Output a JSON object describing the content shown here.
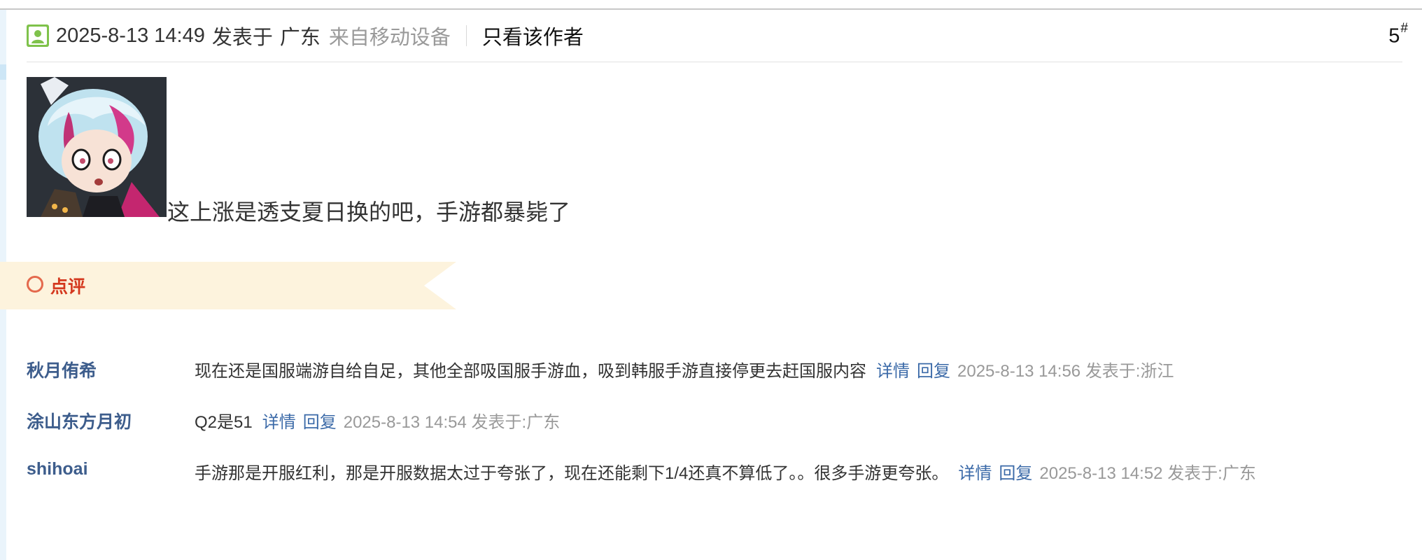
{
  "header": {
    "time": "2025-8-13 14:49",
    "posted_at": "发表于",
    "location": "广东",
    "device": "来自移动设备",
    "only_author": "只看该作者",
    "floor_number": "5",
    "floor_symbol": "#"
  },
  "post": {
    "avatar_icon": "anime-character-avatar",
    "text": "这上涨是透支夏日换的吧，手游都暴毙了"
  },
  "comment_section": {
    "label": "点评",
    "banner_color": "#fdf3dd",
    "label_color": "#d4381e"
  },
  "comments": [
    {
      "user": "秋月侑希",
      "text": "现在还是国服端游自给自足，其他全部吸国服手游血，吸到韩服手游直接停更去赶国服内容",
      "detail": "详情",
      "reply": "回复",
      "meta": "2025-8-13 14:56 发表于:浙江"
    },
    {
      "user": "涂山东方月初",
      "text": "Q2是51",
      "detail": "详情",
      "reply": "回复",
      "meta": "2025-8-13 14:54 发表于:广东"
    },
    {
      "user": "shihoai",
      "text": "手游那是开服红利，那是开服数据太过于夸张了，现在还能剩下1/4还真不算低了。。很多手游更夸张。",
      "detail": "详情",
      "reply": "回复",
      "meta": "2025-8-13 14:52 发表于:广东"
    }
  ],
  "colors": {
    "link": "#3b6aa8",
    "username": "#3d5d8c",
    "meta_gray": "#999999",
    "user_icon_green": "#7fc24b"
  }
}
